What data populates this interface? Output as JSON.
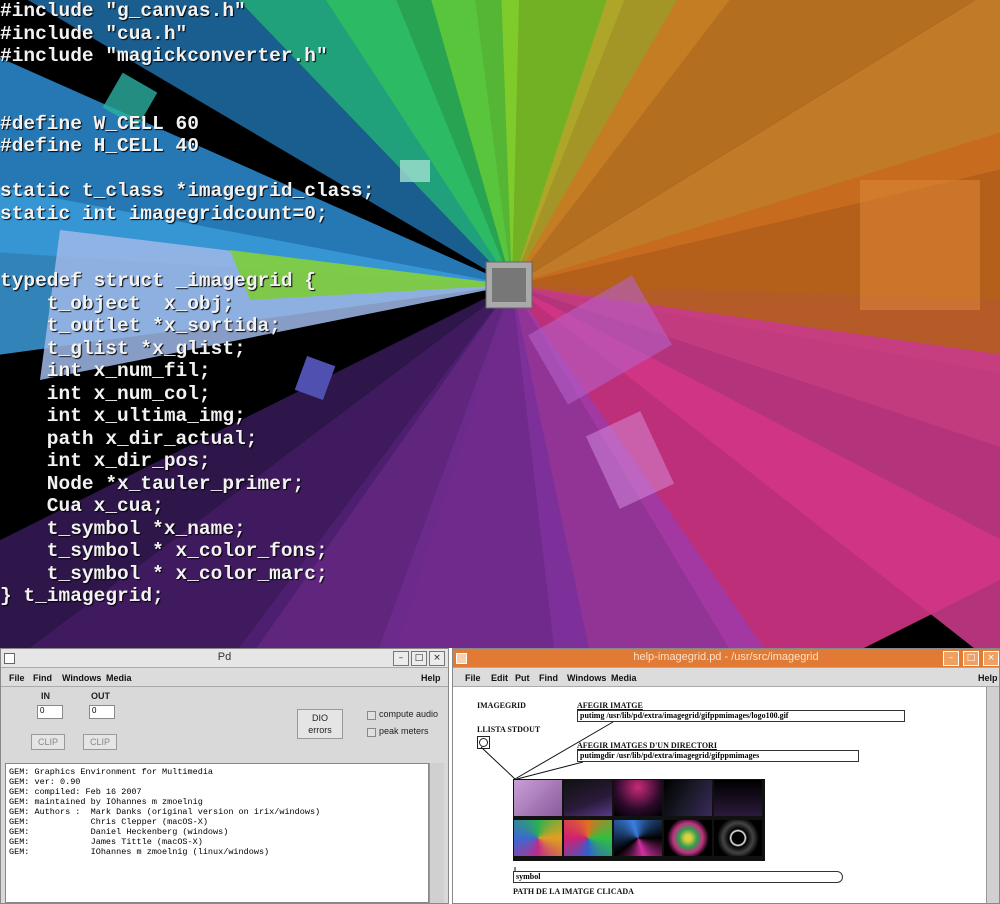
{
  "code": {
    "lines": [
      "#include \"g_canvas.h\"",
      "#include \"cua.h\"",
      "#include \"magickconverter.h\"",
      "",
      "",
      "#define W_CELL 60",
      "#define H_CELL 40",
      "",
      "static t_class *imagegrid_class;",
      "static int imagegridcount=0;",
      "",
      "",
      "typedef struct _imagegrid {",
      "    t_object  x_obj;",
      "    t_outlet *x_sortida;",
      "    t_glist *x_glist;",
      "    int x_num_fil;",
      "    int x_num_col;",
      "    int x_ultima_img;",
      "    path x_dir_actual;",
      "    int x_dir_pos;",
      "    Node *x_tauler_primer;",
      "    Cua x_cua;",
      "    t_symbol *x_name;",
      "    t_symbol * x_color_fons;",
      "    t_symbol * x_color_marc;",
      "} t_imagegrid;"
    ]
  },
  "pd_window": {
    "title": "Pd",
    "menu": [
      "File",
      "Find",
      "Windows",
      "Media"
    ],
    "help": "Help",
    "in_label": "IN",
    "out_label": "OUT",
    "in_value": "0",
    "out_value": "0",
    "clip_in": "CLIP",
    "clip_out": "CLIP",
    "dio_label": "DIO",
    "errors_label": "errors",
    "compute_audio": "compute audio",
    "peak_meters": "peak meters",
    "console": [
      "GEM: Graphics Environment for Multimedia",
      "GEM: ver: 0.90",
      "GEM: compiled: Feb 16 2007",
      "GEM: maintained by IOhannes m zmoelnig",
      "GEM: Authors :  Mark Danks (original version on irix/windows)",
      "GEM:            Chris Clepper (macOS-X)",
      "GEM:            Daniel Heckenberg (windows)",
      "GEM:            James Tittle (macOS-X)",
      "GEM:            IOhannes m zmoelnig (linux/windows)"
    ]
  },
  "help_window": {
    "title": "help-imagegrid.pd - /usr/src/imagegrid",
    "menu": [
      "File",
      "Edit",
      "Put",
      "Find",
      "Windows",
      "Media"
    ],
    "help": "Help",
    "imagegrid_label": "IMAGEGRID",
    "afegir_imatge": "AFEGIR IMATGE",
    "putimg_msg": "putimg /usr/lib/pd/extra/imagegrid/gifppmimages/logo100.gif",
    "llista_stdout": "LLISTA STDOUT",
    "afegir_dir": "AFEGIR IMATGES D'UN DIRECTORI",
    "putimgdir_msg": "putimgdir /usr/lib/pd/extra/imagegrid/gifppmimages",
    "symbol_box": "symbol",
    "path_label": "PATH DE LA IMATGE CLICADA"
  },
  "colors": {
    "accent_orange": "#e8792a",
    "background": "#000000"
  }
}
